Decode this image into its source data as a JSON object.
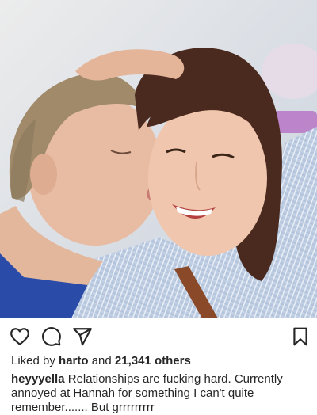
{
  "post": {
    "image_alt": "Photo of two people on a bed, one kissing the other's cheek",
    "actions": {
      "like_icon": "heart-outline-icon",
      "comment_icon": "speech-bubble-icon",
      "share_icon": "paper-plane-icon",
      "save_icon": "bookmark-outline-icon"
    },
    "likes": {
      "prefix": "Liked by",
      "user": "harto",
      "joiner": "and",
      "others": "21,341 others"
    },
    "caption": {
      "username": "heyyyella",
      "text": " Relationships are fucking hard.  Currently annoyed at Hannah for something I can't quite remember....... But grrrrrrrrr"
    }
  }
}
